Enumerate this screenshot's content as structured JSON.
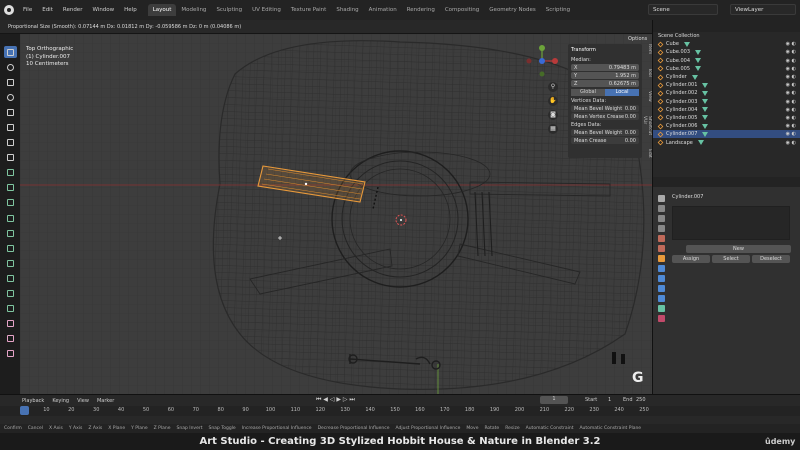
{
  "menu": [
    "File",
    "Edit",
    "Render",
    "Window",
    "Help"
  ],
  "workspace_tabs": [
    "Layout",
    "Modeling",
    "Sculpting",
    "UV Editing",
    "Texture Paint",
    "Shading",
    "Animation",
    "Rendering",
    "Compositing",
    "Geometry Nodes",
    "Scripting"
  ],
  "active_tab": "Layout",
  "scene_name": "Scene",
  "view_layer": "ViewLayer",
  "header_hint": "Proportional Size (Smooth): 0.07144 m   Dx: 0.01812 m   Dy: -0.059586 m   Dz: 0 m (0.04086 m)",
  "viewport": {
    "view_name": "Top Orthographic",
    "object_label": "(1) Cylinder.007",
    "scale_label": "10 Centimeters"
  },
  "npanel": {
    "title": "Transform",
    "median_label": "Median:",
    "x_label": "X",
    "x": "0.79483 m",
    "y_label": "Y",
    "y": "1.952 m",
    "z_label": "Z",
    "z": "0.62675 m",
    "global": "Global",
    "local": "Local",
    "vertices_label": "Vertices Data:",
    "mean_bevel_weight": "Mean Bevel Weight",
    "mean_vertex_crease": "Mean Vertex Crease",
    "edges_label": "Edges Data:",
    "mean_crease": "Mean Crease",
    "zero": "0.00",
    "options": "Options",
    "side_tabs": [
      "Item",
      "Tool",
      "View",
      "Shortcut VUr",
      "Edit"
    ]
  },
  "outliner": {
    "collection": "Scene Collection",
    "items": [
      {
        "name": "Cube",
        "sel": false
      },
      {
        "name": "Cube.003",
        "sel": false
      },
      {
        "name": "Cube.004",
        "sel": false
      },
      {
        "name": "Cube.005",
        "sel": false
      },
      {
        "name": "Cylinder",
        "sel": false
      },
      {
        "name": "Cylinder.001",
        "sel": false
      },
      {
        "name": "Cylinder.002",
        "sel": false
      },
      {
        "name": "Cylinder.003",
        "sel": false
      },
      {
        "name": "Cylinder.004",
        "sel": false
      },
      {
        "name": "Cylinder.005",
        "sel": false
      },
      {
        "name": "Cylinder.006",
        "sel": false
      },
      {
        "name": "Cylinder.007",
        "sel": true
      },
      {
        "name": "Landscape",
        "sel": false
      }
    ]
  },
  "properties": {
    "material_object": "Cylinder.007",
    "new_label": "New",
    "assign": "Assign",
    "select": "Select",
    "deselect": "Deselect"
  },
  "timeline": {
    "playback": "Playback",
    "keying": "Keying",
    "view": "View",
    "marker": "Marker",
    "current_frame": "1",
    "start_label": "Start",
    "start": "1",
    "end_label": "End",
    "end": "250",
    "ticks": [
      "1",
      "10",
      "20",
      "30",
      "40",
      "50",
      "60",
      "70",
      "80",
      "90",
      "100",
      "110",
      "120",
      "130",
      "140",
      "150",
      "160",
      "170",
      "180",
      "190",
      "200",
      "210",
      "220",
      "230",
      "240",
      "250"
    ]
  },
  "statusbar": [
    "Confirm",
    "Cancel",
    "X Axis",
    "Y Axis",
    "Z Axis",
    "X Plane",
    "Y Plane",
    "Z Plane",
    "Snap Invert",
    "Snap Toggle",
    "Increase Proportional Influence",
    "Decrease Proportional Influence",
    "Adjust Proportional Influence",
    "Move",
    "Rotate",
    "Resize",
    "Automatic Constraint",
    "Automatic Constraint Plane"
  ],
  "footer_title": "Art Studio - Creating 3D Stylized Hobbit House & Nature in Blender 3.2",
  "brand": "ûdemy",
  "G_label": "G",
  "colors": {
    "accent": "#4772b3",
    "selection_orange": "#e99a3b",
    "axis_red": "#b83a3a",
    "axis_green": "#6ca33a"
  }
}
